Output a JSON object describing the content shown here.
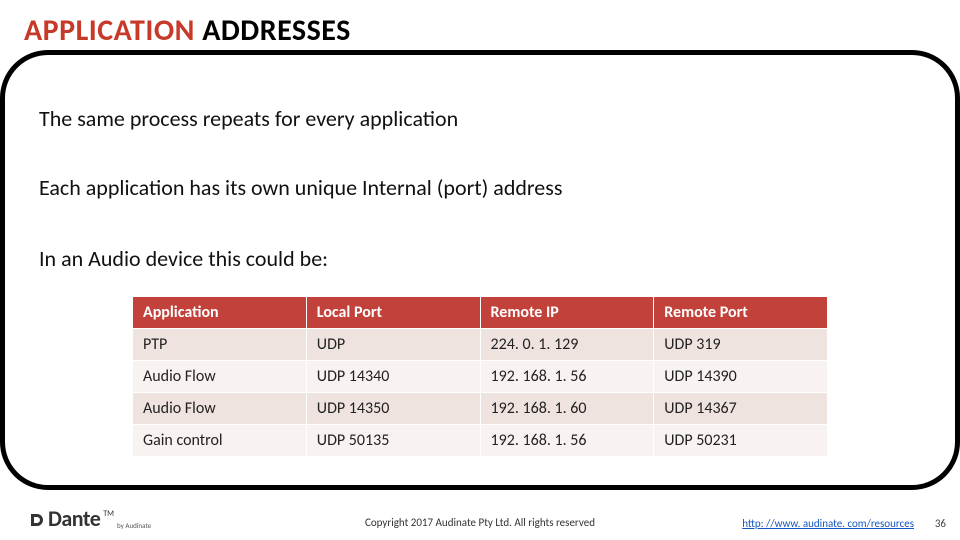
{
  "title": {
    "accent": "APPLICATION",
    "rest": " ADDRESSES"
  },
  "paragraphs": {
    "p1": "The same process repeats for every application",
    "p2": "Each application has its own unique Internal (port) address",
    "p3": "In an Audio device this could be:"
  },
  "table": {
    "headers": [
      "Application",
      "Local Port",
      "Remote IP",
      "Remote Port"
    ],
    "rows": [
      [
        "PTP",
        "UDP",
        "224. 0. 1. 129",
        "UDP 319"
      ],
      [
        "Audio Flow",
        "UDP 14340",
        "192. 168. 1. 56",
        "UDP 14390"
      ],
      [
        "Audio Flow",
        "UDP 14350",
        "192. 168. 1. 60",
        "UDP 14367"
      ],
      [
        "Gain control",
        "UDP 50135",
        "192. 168. 1. 56",
        "UDP 50231"
      ]
    ]
  },
  "footer": {
    "copyright": "Copyright 2017 Audinate Pty Ltd. All rights reserved",
    "link_text": "http: //www. audinate. com/resources",
    "link_href": "http://www.audinate.com/resources",
    "page": "36",
    "brand": "Dante",
    "tm": "TM",
    "by": "by Audinate"
  }
}
